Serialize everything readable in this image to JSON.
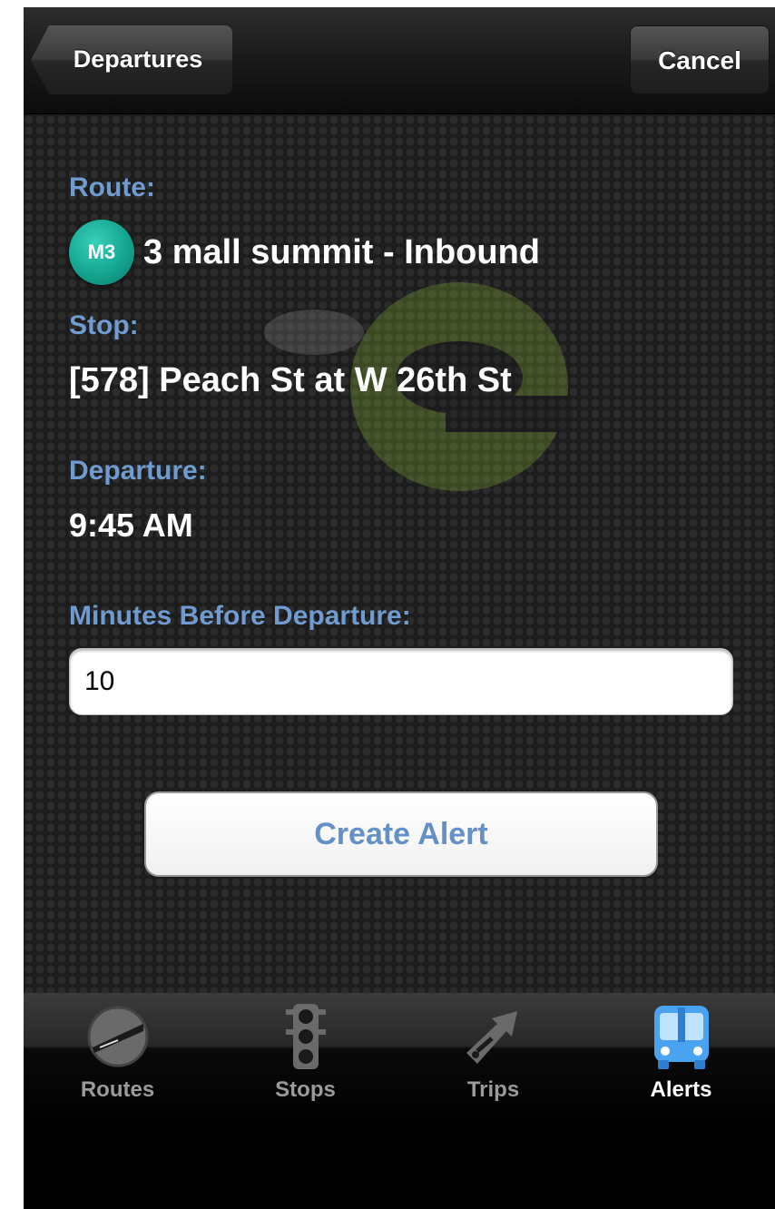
{
  "nav": {
    "back_label": "Departures",
    "cancel_label": "Cancel"
  },
  "form": {
    "route_label": "Route:",
    "route_badge": "M3",
    "route_name": "3 mall summit - Inbound",
    "stop_label": "Stop:",
    "stop_value": "[578] Peach St at W 26th St",
    "departure_label": "Departure:",
    "departure_value": "9:45 AM",
    "minutes_label": "Minutes Before Departure:",
    "minutes_value": "10",
    "create_button": "Create Alert"
  },
  "tabs": [
    {
      "label": "Routes",
      "icon": "road-icon",
      "active": false
    },
    {
      "label": "Stops",
      "icon": "traffic-light-icon",
      "active": false
    },
    {
      "label": "Trips",
      "icon": "trip-arrow-icon",
      "active": false
    },
    {
      "label": "Alerts",
      "icon": "bus-icon",
      "active": true
    }
  ],
  "colors": {
    "label_blue": "#6f9bd1",
    "badge_teal": "#14a590",
    "active_tab_blue": "#4aa3f0"
  }
}
